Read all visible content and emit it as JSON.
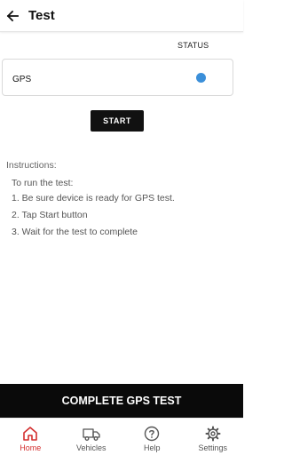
{
  "header": {
    "title": "Test"
  },
  "status_column": {
    "label": "STATUS"
  },
  "tests": [
    {
      "name": "GPS",
      "status_color": "#3b8fd9"
    }
  ],
  "start_button": {
    "label": "START"
  },
  "instructions": {
    "heading": "Instructions:",
    "intro": "To run the test:",
    "steps": [
      "1. Be sure device is ready for GPS test.",
      "2. Tap Start button",
      "3. Wait for the test to complete"
    ]
  },
  "complete_button": {
    "label": "COMPLETE GPS TEST"
  },
  "bottom_nav": {
    "active": "Home",
    "active_color": "#d32f2f",
    "items": [
      {
        "label": "Home",
        "icon": "home-icon"
      },
      {
        "label": "Vehicles",
        "icon": "truck-icon"
      },
      {
        "label": "Help",
        "icon": "help-icon"
      },
      {
        "label": "Settings",
        "icon": "gear-icon"
      }
    ]
  }
}
